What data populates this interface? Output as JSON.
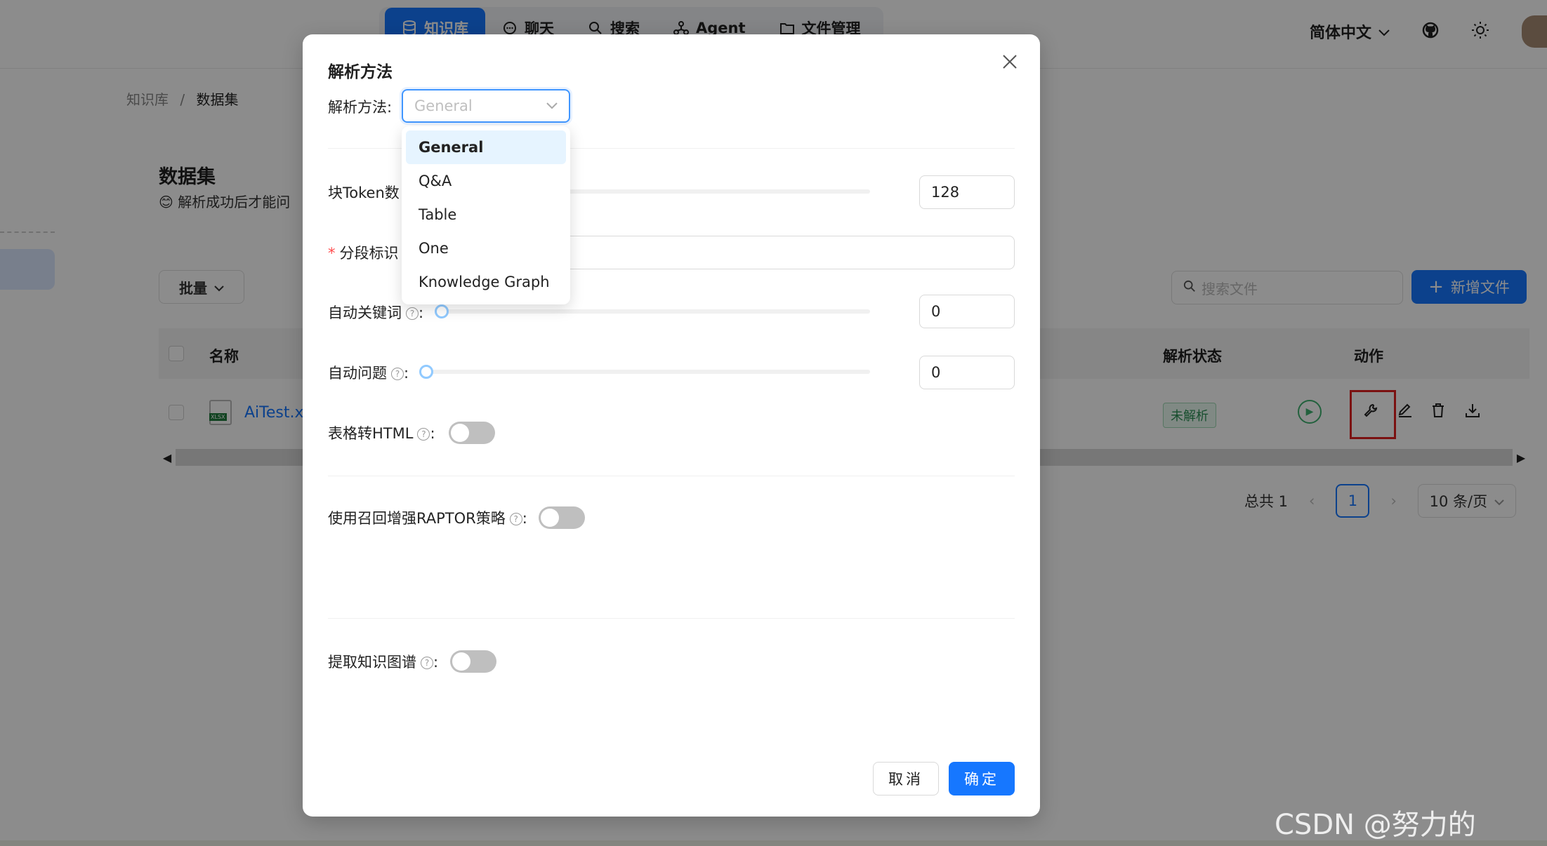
{
  "nav": {
    "items": [
      {
        "label": "知识库",
        "icon": "database-icon",
        "active": true
      },
      {
        "label": "聊天",
        "icon": "chat-icon",
        "active": false
      },
      {
        "label": "搜索",
        "icon": "search-icon",
        "active": false
      },
      {
        "label": "Agent",
        "icon": "agent-icon",
        "active": false
      },
      {
        "label": "文件管理",
        "icon": "folder-icon",
        "active": false
      }
    ],
    "language": "简体中文"
  },
  "breadcrumb": {
    "root": "知识库",
    "separator": "/",
    "current": "数据集"
  },
  "page": {
    "title": "数据集",
    "subtitle": "😊 解析成功后才能问",
    "batch_label": "批量",
    "search_placeholder": "搜索文件",
    "add_file_label": "新增文件"
  },
  "table": {
    "headers": {
      "name": "名称",
      "parse_status": "解析状态",
      "actions": "动作"
    },
    "rows": [
      {
        "name": "AiTest.xl",
        "status": "未解析"
      }
    ]
  },
  "pagination": {
    "total": "总共 1",
    "current": "1",
    "page_size": "10 条/页"
  },
  "modal": {
    "title": "解析方法",
    "parse_method_label": "解析方法:",
    "parse_method_placeholder": "General",
    "token_label": "块Token数",
    "token_value": "128",
    "delimiter_label": "分段标识",
    "auto_keywords_label": "自动关键词",
    "auto_keywords_value": "0",
    "auto_questions_label": "自动问题",
    "auto_questions_value": "0",
    "table_html_label": "表格转HTML",
    "raptor_label": "使用召回增强RAPTOR策略",
    "knowledge_graph_label": "提取知识图谱",
    "colon": ":",
    "cancel_label": "取消",
    "ok_label": "确定"
  },
  "dropdown": {
    "options": [
      "General",
      "Q&A",
      "Table",
      "One",
      "Knowledge Graph"
    ],
    "selected": "General"
  },
  "watermark": "CSDN @努力的Andy",
  "colors": {
    "primary": "#1677ff",
    "highlight": "#e02020",
    "status_green": "#2b8f54"
  }
}
